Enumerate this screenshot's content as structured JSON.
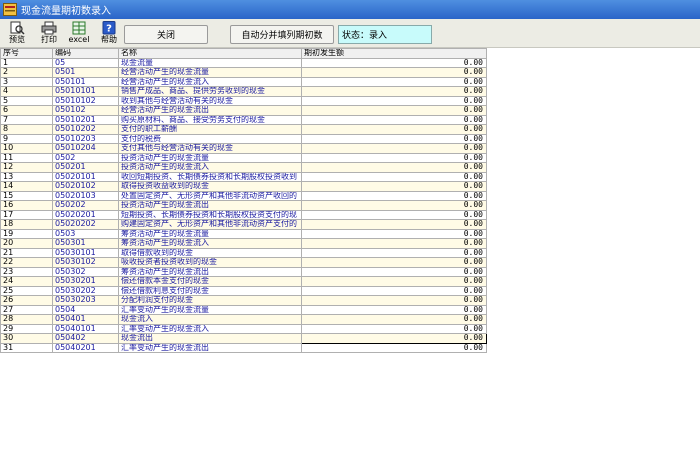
{
  "window": {
    "title": "现金流量期初数录入"
  },
  "toolbar": {
    "tools": [
      {
        "label": "预览",
        "icon": "preview-icon"
      },
      {
        "label": "打印",
        "icon": "printer-icon"
      },
      {
        "label": "excel",
        "icon": "excel-icon"
      },
      {
        "label": "帮助",
        "icon": "help-icon"
      }
    ],
    "close_label": "关闭",
    "auto_fill_label": "自动分并填列期初数",
    "status_text": "状态：录入"
  },
  "table": {
    "headers": [
      "序号",
      "编码",
      "名称",
      "期初发生额"
    ],
    "rows": [
      {
        "seq": "1",
        "code": "05",
        "name": "现金流量",
        "amount": "0.00"
      },
      {
        "seq": "2",
        "code": "0501",
        "name": "经营活动产生的现金流量",
        "amount": "0.00"
      },
      {
        "seq": "3",
        "code": "050101",
        "name": "经营活动产生的现金流入",
        "amount": "0.00"
      },
      {
        "seq": "4",
        "code": "05010101",
        "name": "销售产成品、商品、提供劳务收到的现金",
        "amount": "0.00"
      },
      {
        "seq": "5",
        "code": "05010102",
        "name": "收到其他与经营活动有关的现金",
        "amount": "0.00"
      },
      {
        "seq": "6",
        "code": "050102",
        "name": "经营活动产生的现金流出",
        "amount": "0.00"
      },
      {
        "seq": "7",
        "code": "05010201",
        "name": "购买原材料、商品、接受劳务支付的现金",
        "amount": "0.00"
      },
      {
        "seq": "8",
        "code": "05010202",
        "name": "支付的职工薪酬",
        "amount": "0.00"
      },
      {
        "seq": "9",
        "code": "05010203",
        "name": "支付的税费",
        "amount": "0.00"
      },
      {
        "seq": "10",
        "code": "05010204",
        "name": "支付其他与经营活动有关的现金",
        "amount": "0.00"
      },
      {
        "seq": "11",
        "code": "0502",
        "name": "投资活动产生的现金流量",
        "amount": "0.00"
      },
      {
        "seq": "12",
        "code": "050201",
        "name": "投资活动产生的现金流入",
        "amount": "0.00"
      },
      {
        "seq": "13",
        "code": "05020101",
        "name": "收回短期投资、长期债券投资和长期股权投资收到",
        "amount": "0.00"
      },
      {
        "seq": "14",
        "code": "05020102",
        "name": "取得投资收益收到的现金",
        "amount": "0.00"
      },
      {
        "seq": "15",
        "code": "05020103",
        "name": "处置固定资产、无形资产和其他非流动资产收回的",
        "amount": "0.00"
      },
      {
        "seq": "16",
        "code": "050202",
        "name": "投资活动产生的现金流出",
        "amount": "0.00"
      },
      {
        "seq": "17",
        "code": "05020201",
        "name": "短期投资、长期债券投资和长期股权投资支付的现",
        "amount": "0.00"
      },
      {
        "seq": "18",
        "code": "05020202",
        "name": "购建固定资产、无形资产和其他非流动资产支付的",
        "amount": "0.00"
      },
      {
        "seq": "19",
        "code": "0503",
        "name": "筹资活动产生的现金流量",
        "amount": "0.00"
      },
      {
        "seq": "20",
        "code": "050301",
        "name": "筹资活动产生的现金流入",
        "amount": "0.00"
      },
      {
        "seq": "21",
        "code": "05030101",
        "name": "取得借款收到的现金",
        "amount": "0.00"
      },
      {
        "seq": "22",
        "code": "05030102",
        "name": "吸收投资者投资收到的现金",
        "amount": "0.00"
      },
      {
        "seq": "23",
        "code": "050302",
        "name": "筹资活动产生的现金流出",
        "amount": "0.00"
      },
      {
        "seq": "24",
        "code": "05030201",
        "name": "偿还借款本金支付的现金",
        "amount": "0.00"
      },
      {
        "seq": "25",
        "code": "05030202",
        "name": "偿还借款利息支付的现金",
        "amount": "0.00"
      },
      {
        "seq": "26",
        "code": "05030203",
        "name": "分配利润支付的现金",
        "amount": "0.00"
      },
      {
        "seq": "27",
        "code": "0504",
        "name": "汇率变动产生的现金流量",
        "amount": "0.00"
      },
      {
        "seq": "28",
        "code": "050401",
        "name": "现金流入",
        "amount": "0.00"
      },
      {
        "seq": "29",
        "code": "05040101",
        "name": "汇率变动产生的现金流入",
        "amount": "0.00"
      },
      {
        "seq": "30",
        "code": "050402",
        "name": "现金流出",
        "amount": "0.00"
      },
      {
        "seq": "31",
        "code": "05040201",
        "name": "汇率变动产生的现金流出",
        "amount": "0.00"
      }
    ]
  }
}
